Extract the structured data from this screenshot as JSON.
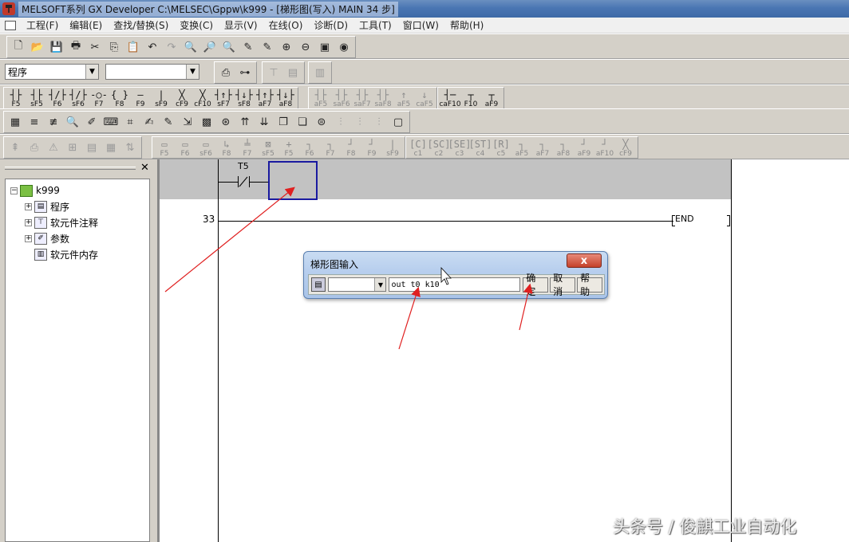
{
  "window": {
    "title": "MELSOFT系列 GX Developer C:\\MELSEC\\Gppw\\k999 - [梯形图(写入)    MAIN    34 步]"
  },
  "menu": [
    "工程(F)",
    "编辑(E)",
    "查找/替换(S)",
    "变换(C)",
    "显示(V)",
    "在线(O)",
    "诊断(D)",
    "工具(T)",
    "窗口(W)",
    "帮助(H)"
  ],
  "toolbar2": {
    "data_type_combo": "程序",
    "second_combo": ""
  },
  "ladder_keys": [
    {
      "sym": "┤├",
      "key": "F5"
    },
    {
      "sym": "┤├",
      "key": "sF5"
    },
    {
      "sym": "┤/├",
      "key": "F6"
    },
    {
      "sym": "┤/├",
      "key": "sF6"
    },
    {
      "sym": "-○-",
      "key": "F7"
    },
    {
      "sym": "{ }",
      "key": "F8"
    },
    {
      "sym": "—",
      "key": "F9"
    },
    {
      "sym": "|",
      "key": "sF9"
    },
    {
      "sym": "╳",
      "key": "cF9"
    },
    {
      "sym": "╳",
      "key": "cF10"
    },
    {
      "sym": "┤↑├",
      "key": "sF7"
    },
    {
      "sym": "┤↓├",
      "key": "sF8"
    },
    {
      "sym": "┤↑├",
      "key": "aF7"
    },
    {
      "sym": "┤↓├",
      "key": "aF8"
    }
  ],
  "ladder_keys_dis": [
    {
      "sym": "┤├",
      "key": "aF5"
    },
    {
      "sym": "┤├",
      "key": "saF6"
    },
    {
      "sym": "┤├",
      "key": "saF7"
    },
    {
      "sym": "┤├",
      "key": "saF8"
    },
    {
      "sym": "↑",
      "key": "aF5"
    },
    {
      "sym": "↓",
      "key": "caF5"
    }
  ],
  "ladder_keys_end": [
    {
      "sym": "┤─",
      "key": "caF10"
    },
    {
      "sym": "┬",
      "key": "F10"
    },
    {
      "sym": "┬",
      "key": "aF9"
    }
  ],
  "sfc_keys_a": [
    {
      "sym": "▭",
      "key": "F5"
    },
    {
      "sym": "▭",
      "key": "F6"
    },
    {
      "sym": "▭",
      "key": "sF6"
    },
    {
      "sym": "↳",
      "key": "F8"
    },
    {
      "sym": "╧",
      "key": "F7"
    },
    {
      "sym": "⊠",
      "key": "sF5"
    },
    {
      "sym": "+",
      "key": "F5"
    },
    {
      "sym": "┐",
      "key": "F6"
    },
    {
      "sym": "┐",
      "key": "F7"
    },
    {
      "sym": "┘",
      "key": "F8"
    },
    {
      "sym": "┘",
      "key": "F9"
    },
    {
      "sym": "|",
      "key": "sF9"
    }
  ],
  "sfc_keys_b": [
    {
      "sym": "[C]",
      "key": "c1"
    },
    {
      "sym": "[SC]",
      "key": "c2"
    },
    {
      "sym": "[SE]",
      "key": "c3"
    },
    {
      "sym": "[ST]",
      "key": "c4"
    },
    {
      "sym": "[R]",
      "key": "c5"
    },
    {
      "sym": "┐",
      "key": "aF5"
    },
    {
      "sym": "┐",
      "key": "aF7"
    },
    {
      "sym": "┐",
      "key": "aF8"
    },
    {
      "sym": "┘",
      "key": "aF9"
    },
    {
      "sym": "┘",
      "key": "aF10"
    },
    {
      "sym": "╳",
      "key": "cF9"
    }
  ],
  "tree": {
    "root": "k999",
    "items": [
      "程序",
      "软元件注释",
      "参数",
      "软元件内存"
    ]
  },
  "ladder": {
    "contact_label": "T5",
    "step_number": "33",
    "end_label": "END"
  },
  "dialog": {
    "title": "梯形图输入",
    "close_label": "x",
    "input_value": "out t0 k10",
    "ok_label": "确定",
    "cancel_label": "取消",
    "help_label": "帮助"
  },
  "watermark": "头条号 / 俊麒工业自动化"
}
